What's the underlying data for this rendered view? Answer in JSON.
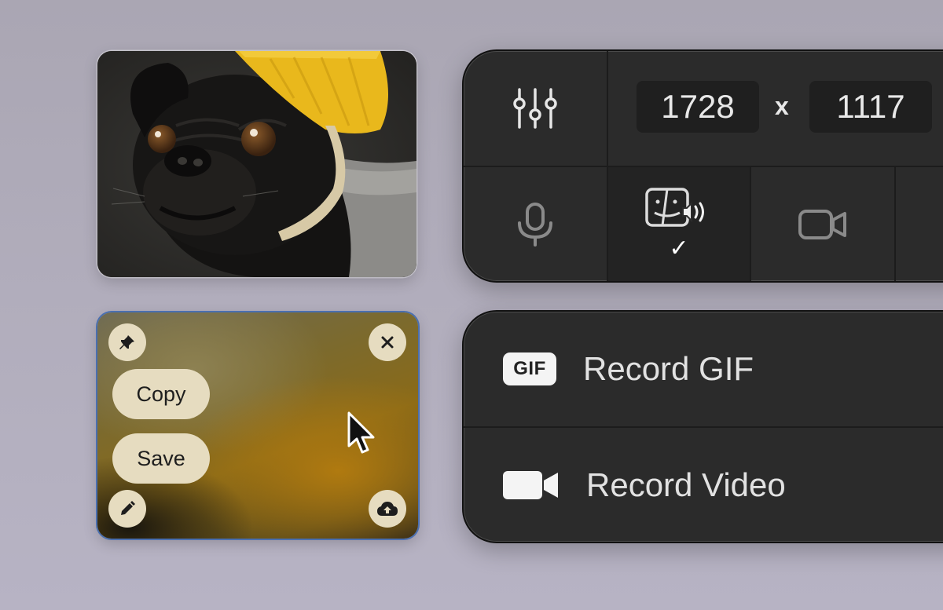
{
  "photo": {
    "alt_icon": "pug-photo"
  },
  "overlay": {
    "copy_label": "Copy",
    "save_label": "Save",
    "icons": [
      "pin-icon",
      "close-icon",
      "edit-icon",
      "cloud-upload-icon"
    ]
  },
  "capture_settings": {
    "width": "1728",
    "separator": "x",
    "height": "1117",
    "audio_option": {
      "selected": true,
      "checkmark": "✓"
    }
  },
  "record_menu": {
    "gif_badge": "GIF",
    "record_gif": "Record GIF",
    "record_video": "Record Video"
  },
  "colors": {
    "panel_bg": "#2b2b2b",
    "overlay_button_bg": "#e6dcc0",
    "accent_border": "#4a6fb0"
  }
}
